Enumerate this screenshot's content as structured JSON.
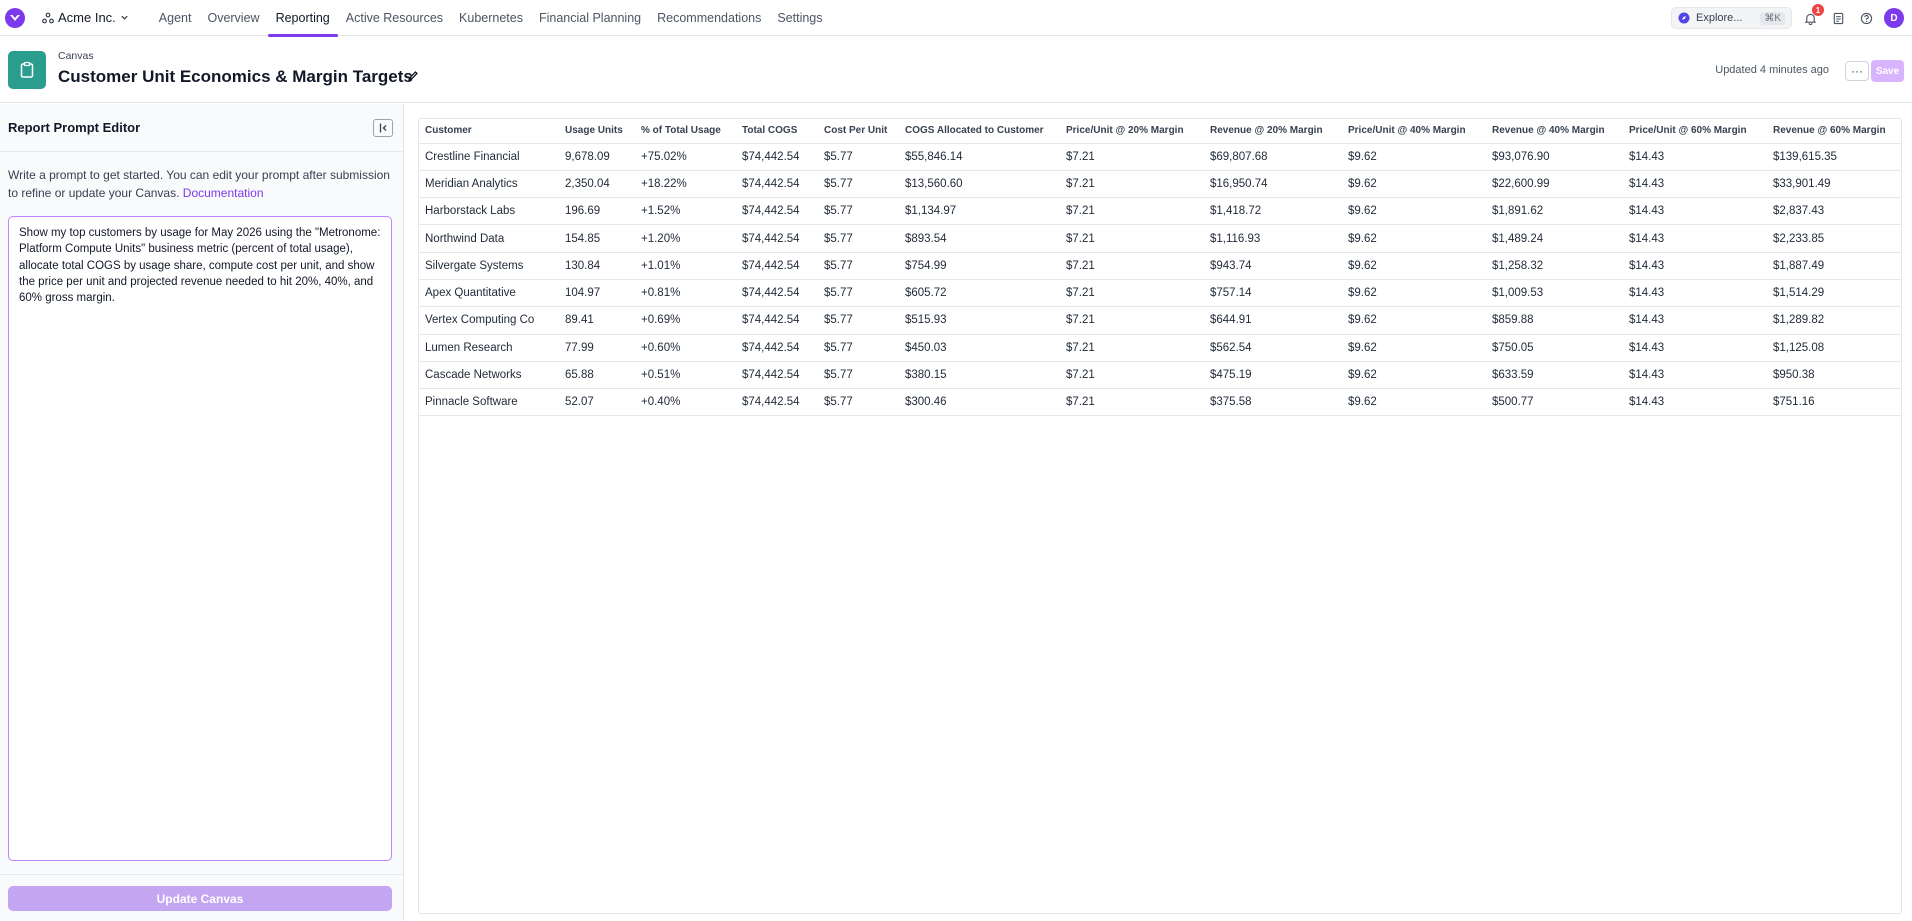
{
  "nav": {
    "org_name": "Acme Inc.",
    "tabs": [
      "Agent",
      "Overview",
      "Reporting",
      "Active Resources",
      "Kubernetes",
      "Financial Planning",
      "Recommendations",
      "Settings"
    ],
    "active_tab": "Reporting",
    "explore_label": "Explore...",
    "explore_shortcut": "⌘K",
    "notification_count": "1",
    "avatar_initial": "D",
    "accent_color": "#7c3aed"
  },
  "header": {
    "breadcrumb": "Canvas",
    "title": "Customer Unit Economics & Margin Targets",
    "updated": "Updated 4 minutes ago",
    "more_label": "···",
    "save_label": "Save"
  },
  "editor": {
    "title": "Report Prompt Editor",
    "intro": "Write a prompt to get started. You can edit your prompt after submission to refine or update your Canvas.",
    "doc_link": "Documentation",
    "prompt": "Show my top customers by usage for May 2026 using the \"Metronome: Platform Compute Units\" business metric (percent of total usage), allocate total COGS by usage share, compute cost per unit, and show the price per unit and projected revenue needed to hit 20%, 40%, and 60% gross margin.",
    "update_button": "Update Canvas"
  },
  "table": {
    "columns": [
      "Customer",
      "Usage Units",
      "% of Total Usage",
      "Total COGS",
      "Cost Per Unit",
      "COGS Allocated to Customer",
      "Price/Unit @ 20% Margin",
      "Revenue @ 20% Margin",
      "Price/Unit @ 40% Margin",
      "Revenue @ 40% Margin",
      "Price/Unit @ 60% Margin",
      "Revenue @ 60% Margin"
    ],
    "rows": [
      [
        "Crestline Financial",
        "9,678.09",
        "+75.02%",
        "$74,442.54",
        "$5.77",
        "$55,846.14",
        "$7.21",
        "$69,807.68",
        "$9.62",
        "$93,076.90",
        "$14.43",
        "$139,615.35"
      ],
      [
        "Meridian Analytics",
        "2,350.04",
        "+18.22%",
        "$74,442.54",
        "$5.77",
        "$13,560.60",
        "$7.21",
        "$16,950.74",
        "$9.62",
        "$22,600.99",
        "$14.43",
        "$33,901.49"
      ],
      [
        "Harborstack Labs",
        "196.69",
        "+1.52%",
        "$74,442.54",
        "$5.77",
        "$1,134.97",
        "$7.21",
        "$1,418.72",
        "$9.62",
        "$1,891.62",
        "$14.43",
        "$2,837.43"
      ],
      [
        "Northwind Data",
        "154.85",
        "+1.20%",
        "$74,442.54",
        "$5.77",
        "$893.54",
        "$7.21",
        "$1,116.93",
        "$9.62",
        "$1,489.24",
        "$14.43",
        "$2,233.85"
      ],
      [
        "Silvergate Systems",
        "130.84",
        "+1.01%",
        "$74,442.54",
        "$5.77",
        "$754.99",
        "$7.21",
        "$943.74",
        "$9.62",
        "$1,258.32",
        "$14.43",
        "$1,887.49"
      ],
      [
        "Apex Quantitative",
        "104.97",
        "+0.81%",
        "$74,442.54",
        "$5.77",
        "$605.72",
        "$7.21",
        "$757.14",
        "$9.62",
        "$1,009.53",
        "$14.43",
        "$1,514.29"
      ],
      [
        "Vertex Computing Co",
        "89.41",
        "+0.69%",
        "$74,442.54",
        "$5.77",
        "$515.93",
        "$7.21",
        "$644.91",
        "$9.62",
        "$859.88",
        "$14.43",
        "$1,289.82"
      ],
      [
        "Lumen Research",
        "77.99",
        "+0.60%",
        "$74,442.54",
        "$5.77",
        "$450.03",
        "$7.21",
        "$562.54",
        "$9.62",
        "$750.05",
        "$14.43",
        "$1,125.08"
      ],
      [
        "Cascade Networks",
        "65.88",
        "+0.51%",
        "$74,442.54",
        "$5.77",
        "$380.15",
        "$7.21",
        "$475.19",
        "$9.62",
        "$633.59",
        "$14.43",
        "$950.38"
      ],
      [
        "Pinnacle Software",
        "52.07",
        "+0.40%",
        "$74,442.54",
        "$5.77",
        "$300.46",
        "$7.21",
        "$375.58",
        "$9.62",
        "$500.77",
        "$14.43",
        "$751.16"
      ]
    ]
  }
}
